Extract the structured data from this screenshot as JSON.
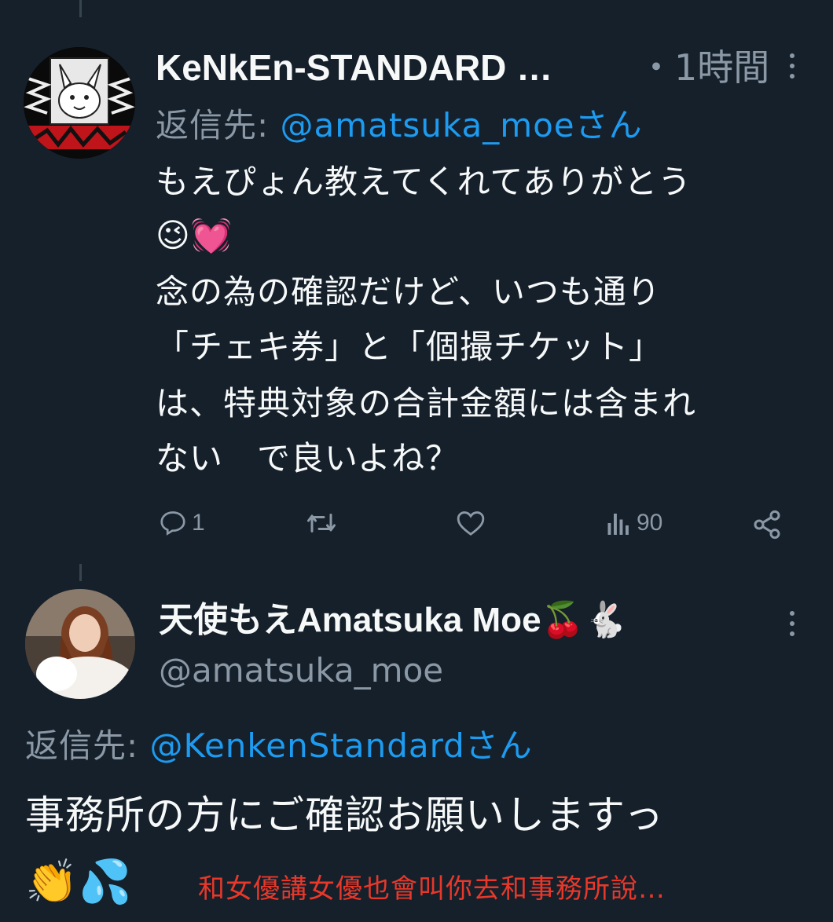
{
  "tweet1": {
    "display_name": "KeNkEn-STANDARD …",
    "time": "・1時間",
    "reply_prefix": "返信先: ",
    "reply_to": "@amatsuka_moeさん",
    "lines": [
      "もえぴょん教えてくれてありがとう",
      "😉💓",
      "念の為の確認だけど、いつも通り",
      "「チェキ券」と「個撮チケット」",
      "は、特典対象の合計金額には含まれ",
      "ない　で良いよね？"
    ],
    "reply_count": "1",
    "view_count": "90"
  },
  "tweet2": {
    "display_name": "天使もえAmatsuka Moe🍒🐇",
    "handle": "@amatsuka_moe",
    "reply_prefix": "返信先: ",
    "reply_to": "@KenkenStandardさん",
    "line1": "事務所の方にご確認お願いしますっ",
    "emoji": "👏💦"
  },
  "caption": "和女優講女優也會叫你去和事務所說…",
  "colors": {
    "background": "#15202b",
    "text": "#f7f9f9",
    "muted": "#8b98a5",
    "link": "#1d9bf0",
    "caption": "#e8382a"
  }
}
